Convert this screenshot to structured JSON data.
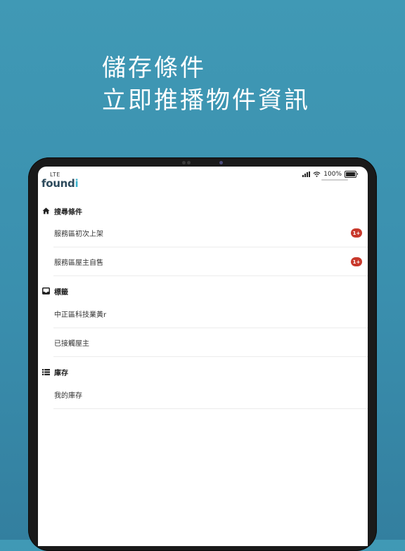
{
  "headline": {
    "line1": "儲存條件",
    "line2": "立即推播物件資訊"
  },
  "status_bar": {
    "carrier": "LTE",
    "battery": "100%"
  },
  "app": {
    "logo_main": "found",
    "logo_accent": "i"
  },
  "sections": {
    "search": {
      "title": "搜尋條件",
      "icon": "home-icon",
      "items": [
        {
          "label": "服務區初次上架",
          "badge": "1+"
        },
        {
          "label": "服務區屋主自售",
          "badge": "1+"
        }
      ]
    },
    "tags": {
      "title": "標籤",
      "icon": "inbox-icon",
      "items": [
        {
          "label": "中正區科技業黃r"
        },
        {
          "label": "已接觸屋主"
        }
      ]
    },
    "inventory": {
      "title": "庫存",
      "icon": "list-icon",
      "items": [
        {
          "label": "我的庫存"
        }
      ]
    }
  },
  "colors": {
    "background": "#3a8fae",
    "badge": "#c8382b",
    "logo_dark": "#2d4a5c",
    "logo_accent": "#3bb3cf"
  }
}
